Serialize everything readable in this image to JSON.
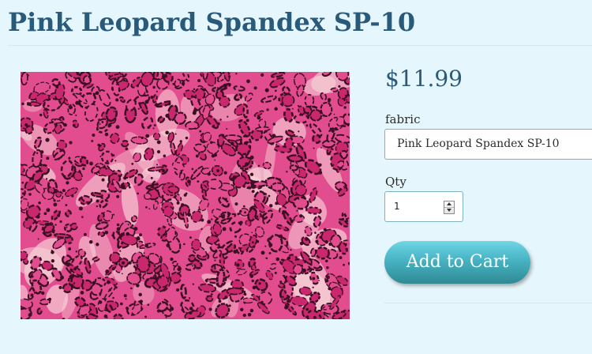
{
  "product": {
    "title": "Pink Leopard Spandex SP-10",
    "price": "$11.99",
    "image_alt": "Pink leopard print spandex fabric"
  },
  "options": {
    "fabric_label": "fabric",
    "fabric_selected": "Pink Leopard Spandex SP-10",
    "qty_label": "Qty",
    "qty_value": "1"
  },
  "actions": {
    "add_to_cart_label": "Add to Cart"
  },
  "colors": {
    "background": "#e6f6fd",
    "title": "#2a5a7a",
    "button_top": "#6fd6e5",
    "button_bottom": "#2f8a93",
    "fabric_pink": "#e24d8f",
    "fabric_dark": "#3d0f22",
    "fabric_light": "#f7d8da"
  }
}
